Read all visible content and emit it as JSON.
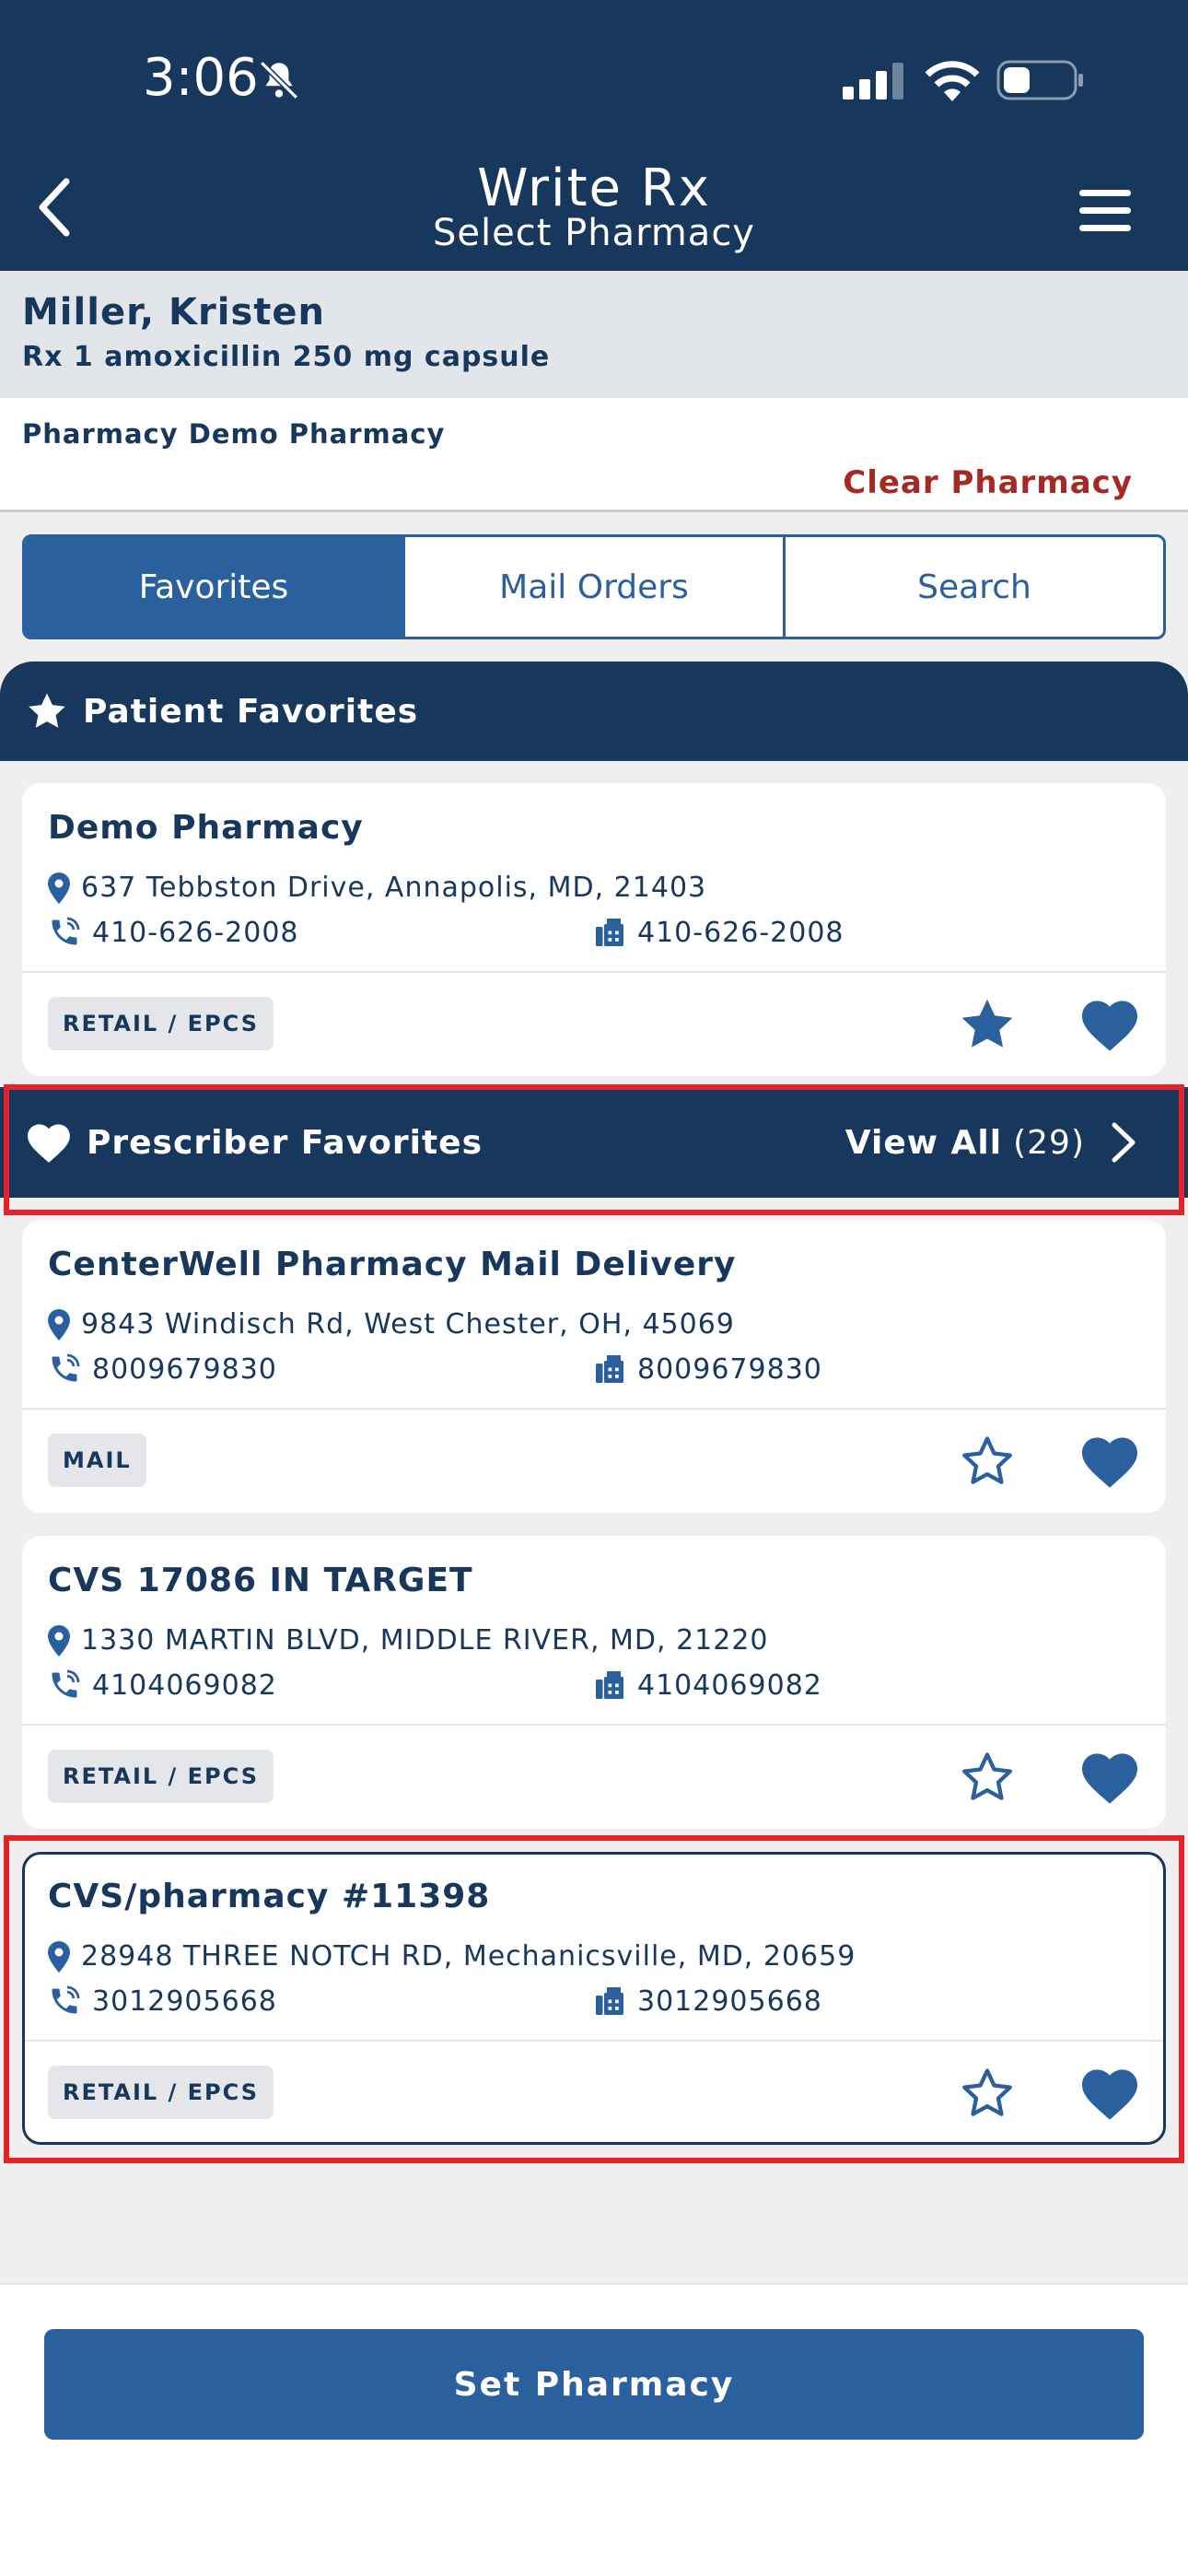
{
  "status_bar": {
    "time": "3:06"
  },
  "header": {
    "title": "Write Rx",
    "subtitle": "Select Pharmacy"
  },
  "patient": {
    "name": "Miller, Kristen",
    "rx": "Rx 1 amoxicillin 250 mg capsule"
  },
  "pharmacy_selection": {
    "label": "Pharmacy Demo Pharmacy",
    "clear_label": "Clear Pharmacy"
  },
  "tabs": [
    {
      "label": "Favorites",
      "active": true
    },
    {
      "label": "Mail Orders",
      "active": false
    },
    {
      "label": "Search",
      "active": false
    }
  ],
  "patient_favorites": {
    "heading": "Patient Favorites",
    "items": [
      {
        "name": "Demo Pharmacy",
        "address": "637 Tebbston Drive, Annapolis, MD, 21403",
        "phone": "410-626-2008",
        "fax": "410-626-2008",
        "type": "RETAIL / EPCS",
        "starred": true,
        "hearted": true
      }
    ]
  },
  "prescriber_favorites": {
    "heading": "Prescriber Favorites",
    "view_all_label": "View All",
    "view_all_count": "(29)",
    "items": [
      {
        "name": "CenterWell Pharmacy Mail Delivery",
        "address": "9843 Windisch Rd, West Chester, OH, 45069",
        "phone": "8009679830",
        "fax": "8009679830",
        "type": "MAIL",
        "starred": false,
        "hearted": true
      },
      {
        "name": "CVS 17086 IN TARGET",
        "address": "1330 MARTIN BLVD, MIDDLE RIVER, MD, 21220",
        "phone": "4104069082",
        "fax": "4104069082",
        "type": "RETAIL / EPCS",
        "starred": false,
        "hearted": true
      },
      {
        "name": "CVS/pharmacy #11398",
        "address": "28948 THREE NOTCH RD, Mechanicsville, MD, 20659",
        "phone": "3012905668",
        "fax": "3012905668",
        "type": "RETAIL / EPCS",
        "starred": false,
        "hearted": true,
        "selected": true
      }
    ]
  },
  "footer": {
    "set_label": "Set Pharmacy"
  },
  "colors": {
    "navy": "#17385c",
    "accent": "#2a609e",
    "clear_red": "#a52a24",
    "highlight": "#e3222b"
  }
}
